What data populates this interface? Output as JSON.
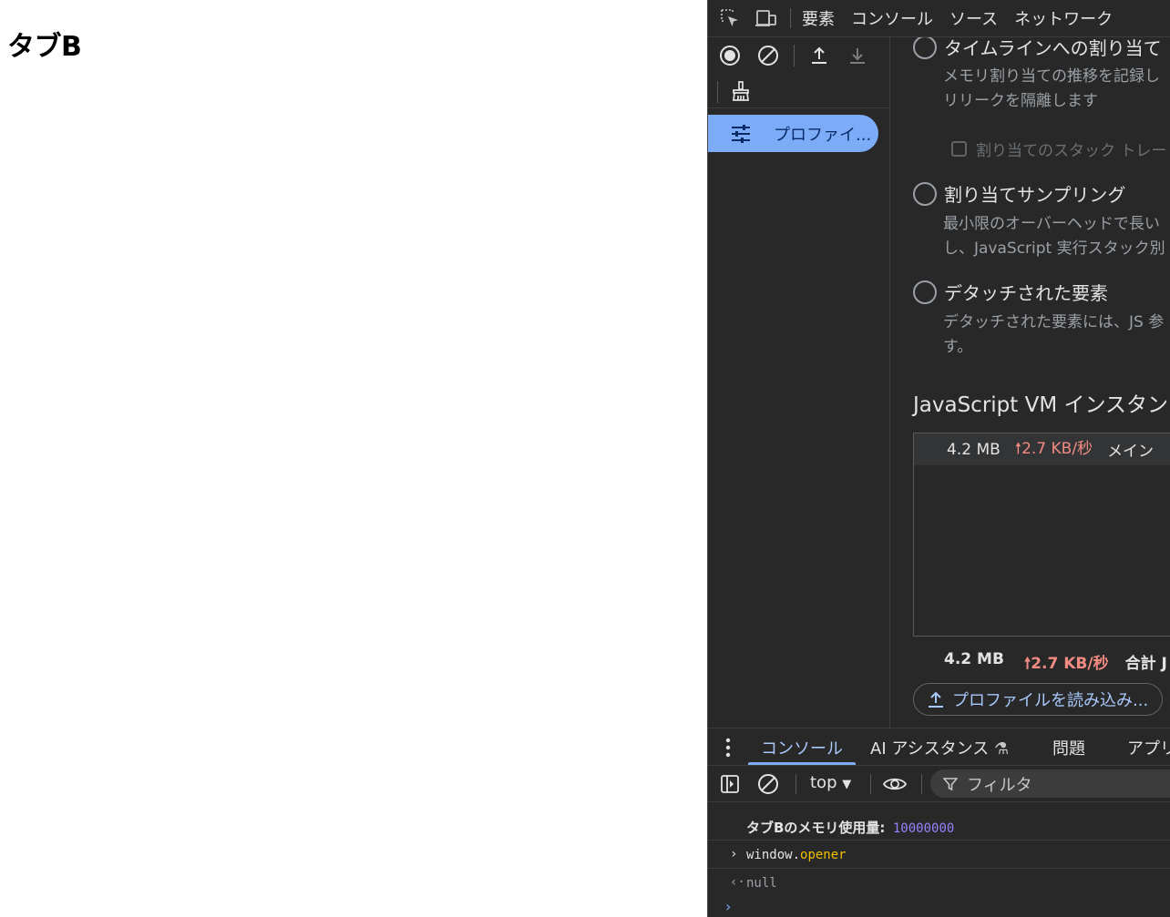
{
  "page": {
    "heading": "タブB"
  },
  "devtools": {
    "top_tabs": [
      "要素",
      "コンソール",
      "ソース",
      "ネットワーク"
    ],
    "sidebar": {
      "profile_item_label": "プロファイ..."
    },
    "profile_types": [
      {
        "label": "タイムラインへの割り当て",
        "desc_lines": [
          "メモリ割り当ての推移を記録し",
          "リリークを隔離します"
        ],
        "checkbox_label": "割り当てのスタック トレー"
      },
      {
        "label": "割り当てサンプリング",
        "desc_lines": [
          "最小限のオーバーヘッドで長い",
          "し、JavaScript 実行スタック別"
        ]
      },
      {
        "label": "デタッチされた要素",
        "desc_lines": [
          "デタッチされた要素には、JS 参",
          "す。"
        ]
      }
    ],
    "vm_section_title": "JavaScript VM インスタン",
    "vm_rows": [
      {
        "size": "4.2 MB",
        "rate": "2.7 KB/秒",
        "name": "メイン"
      }
    ],
    "total": {
      "size": "4.2 MB",
      "rate": "2.7 KB/秒",
      "label": "合計 J"
    },
    "load_button_label": "プロファイルを読み込み...",
    "drawer_tabs": [
      "コンソール",
      "AI アシスタンス",
      "問題",
      "アプリ"
    ],
    "console_context": "top",
    "filter_placeholder": "フィルタ",
    "console_lines": {
      "log_text": "タブBのメモリ使用量:",
      "log_value": "10000000",
      "input_object": "window.",
      "input_property": "opener",
      "result": "null"
    }
  }
}
